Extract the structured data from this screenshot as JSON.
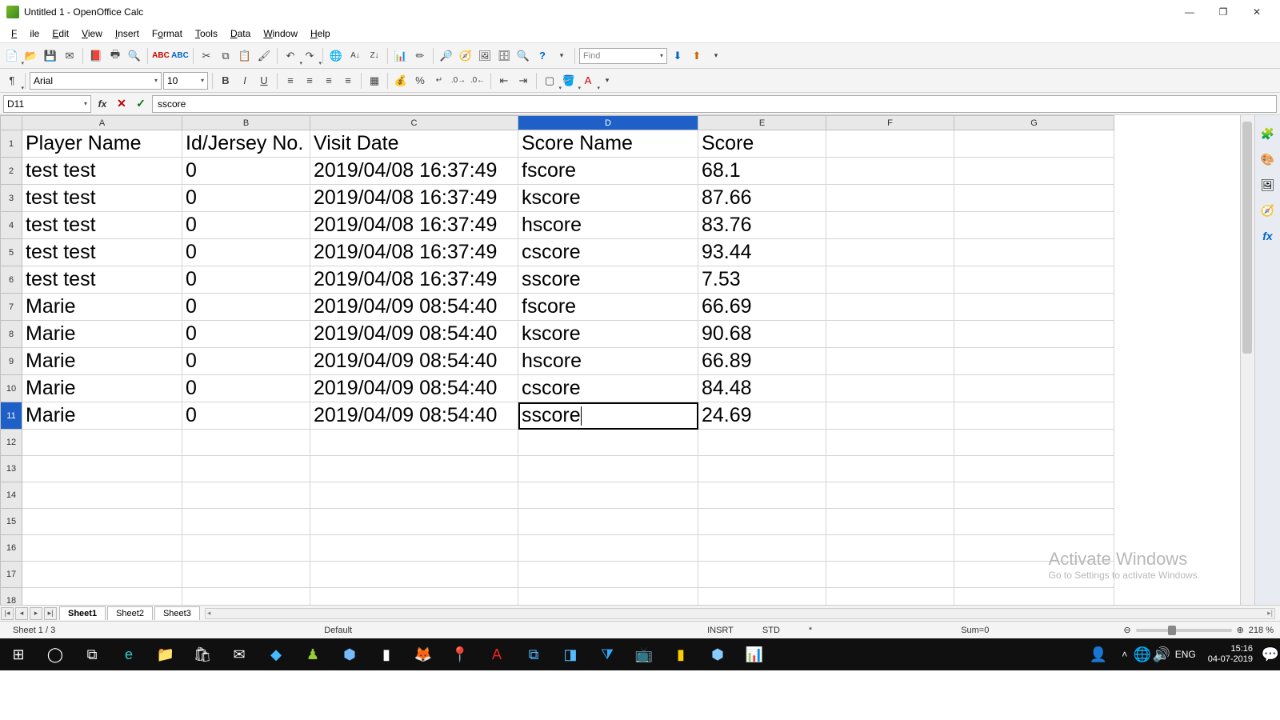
{
  "titlebar": {
    "title": "Untitled 1 - OpenOffice Calc"
  },
  "menu": {
    "file": "File",
    "edit": "Edit",
    "view": "View",
    "insert": "Insert",
    "format": "Format",
    "tools": "Tools",
    "data": "Data",
    "window": "Window",
    "help": "Help"
  },
  "find": {
    "placeholder": "Find"
  },
  "font": {
    "name": "Arial",
    "size": "10"
  },
  "formula": {
    "cellref": "D11",
    "value": "sscore"
  },
  "columns": [
    "A",
    "B",
    "C",
    "D",
    "E",
    "F",
    "G"
  ],
  "selected_col": "D",
  "selected_row": 11,
  "headers": {
    "A": "Player Name",
    "B": "Id/Jersey No.",
    "C": "Visit Date",
    "D": "Score Name",
    "E": "Score"
  },
  "rows": [
    {
      "A": "test test",
      "B": "0",
      "C": "2019/04/08 16:37:49",
      "D": "fscore",
      "E": "68.1"
    },
    {
      "A": "test test",
      "B": "0",
      "C": "2019/04/08 16:37:49",
      "D": "kscore",
      "E": "87.66"
    },
    {
      "A": "test test",
      "B": "0",
      "C": "2019/04/08 16:37:49",
      "D": "hscore",
      "E": "83.76"
    },
    {
      "A": "test test",
      "B": "0",
      "C": "2019/04/08 16:37:49",
      "D": "cscore",
      "E": "93.44"
    },
    {
      "A": "test test",
      "B": "0",
      "C": "2019/04/08 16:37:49",
      "D": "sscore",
      "E": "7.53"
    },
    {
      "A": "Marie",
      "B": "0",
      "C": "2019/04/09 08:54:40",
      "D": "fscore",
      "E": "66.69"
    },
    {
      "A": "Marie",
      "B": "0",
      "C": "2019/04/09 08:54:40",
      "D": "kscore",
      "E": "90.68"
    },
    {
      "A": "Marie",
      "B": "0",
      "C": "2019/04/09 08:54:40",
      "D": "hscore",
      "E": "66.89"
    },
    {
      "A": "Marie",
      "B": "0",
      "C": "2019/04/09 08:54:40",
      "D": "cscore",
      "E": "84.48"
    },
    {
      "A": "Marie",
      "B": "0",
      "C": "2019/04/09 08:54:40",
      "D": "sscore",
      "E": "24.69"
    }
  ],
  "empty_rows": 7,
  "tabs": {
    "t1": "Sheet1",
    "t2": "Sheet2",
    "t3": "Sheet3"
  },
  "status": {
    "sheet": "Sheet 1 / 3",
    "style": "Default",
    "mode": "INSRT",
    "std": "STD",
    "mod": "*",
    "sum": "Sum=0",
    "zoom": "218 %"
  },
  "watermark": {
    "t": "Activate Windows",
    "s": "Go to Settings to activate Windows."
  },
  "tray": {
    "lang": "ENG",
    "time": "15:16",
    "date": "04-07-2019"
  }
}
